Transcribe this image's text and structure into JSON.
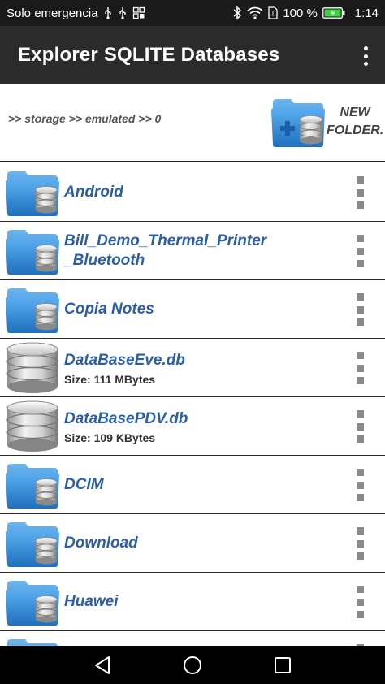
{
  "status_bar": {
    "carrier": "Solo emergencia",
    "battery": "100 %",
    "time": "1:14",
    "icons": [
      "usb-icon",
      "usb-icon",
      "gallery-icon",
      "bluetooth-icon",
      "wifi-icon",
      "sim-icon",
      "battery-icon"
    ]
  },
  "app_bar": {
    "title": "Explorer SQLITE Databases",
    "menu_icon": "overflow-menu-icon"
  },
  "path_bar": {
    "path": ">> storage >> emulated >> 0",
    "new_folder_line1": "NEW",
    "new_folder_line2": "FOLDER."
  },
  "files": [
    {
      "name": "Android",
      "type": "folder"
    },
    {
      "name": "Bill_Demo_Thermal_Printer_Bluetooth",
      "name_line1": "Bill_Demo_Thermal_Printer",
      "name_line2": "_Bluetooth",
      "type": "folder"
    },
    {
      "name": "Copia Notes",
      "type": "folder"
    },
    {
      "name": "DataBaseEve.db",
      "type": "database",
      "size": "Size: 111 MBytes"
    },
    {
      "name": "DataBasePDV.db",
      "type": "database",
      "size": "Size: 109 KBytes"
    },
    {
      "name": "DCIM",
      "type": "folder"
    },
    {
      "name": "Download",
      "type": "folder"
    },
    {
      "name": "Huawei",
      "type": "folder"
    }
  ],
  "colors": {
    "status_bar": "#1a1a1a",
    "app_bar": "#2b2b2b",
    "file_name": "#2b5ea7",
    "folder_blue": "#3a8fd8",
    "menu_gray": "#8a8a8a"
  },
  "nav_bar": {
    "icons": [
      "back-icon",
      "home-icon",
      "recents-icon"
    ]
  }
}
